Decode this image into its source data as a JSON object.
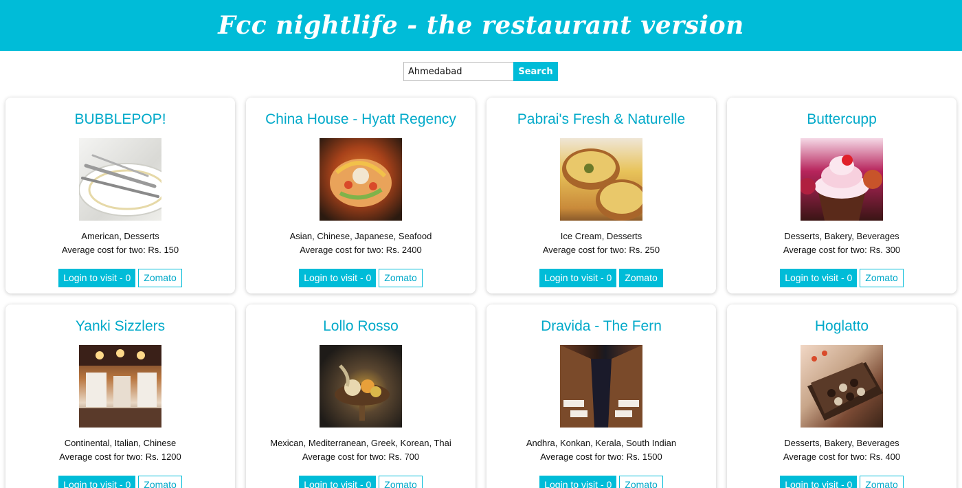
{
  "header": {
    "title": "Fcc nightlife - the restaurant version"
  },
  "search": {
    "value": "Ahmedabad",
    "button_label": "Search"
  },
  "colors": {
    "accent": "#00bcd8",
    "title_text": "#00a9c9"
  },
  "restaurants": [
    {
      "name": "BUBBLEPOP!",
      "cuisine": "American, Desserts",
      "cost": "Average cost for two: Rs. 150",
      "login_label": "Login to visit - 0",
      "zomato_label": "Zomato",
      "image_icon": "plate-cutlery-icon"
    },
    {
      "name": "China House - Hyatt Regency",
      "cuisine": "Asian, Chinese, Japanese, Seafood",
      "cost": "Average cost for two: Rs. 2400",
      "login_label": "Login to visit - 0",
      "zomato_label": "Zomato",
      "image_icon": "salad-dish-icon"
    },
    {
      "name": "Pabrai's Fresh & Naturelle",
      "cuisine": "Ice Cream, Desserts",
      "cost": "Average cost for two: Rs. 250",
      "login_label": "Login to visit - 0",
      "zomato_label": "Zomato",
      "image_icon": "dessert-bowl-icon"
    },
    {
      "name": "Buttercupp",
      "cuisine": "Desserts, Bakery, Beverages",
      "cost": "Average cost for two: Rs. 300",
      "login_label": "Login to visit - 0",
      "zomato_label": "Zomato",
      "image_icon": "cupcake-icon"
    },
    {
      "name": "Yanki Sizzlers",
      "cuisine": "Continental, Italian, Chinese",
      "cost": "Average cost for two: Rs. 1200",
      "login_label": "Login to visit - 0",
      "zomato_label": "Zomato",
      "image_icon": "restaurant-interior-icon"
    },
    {
      "name": "Lollo Rosso",
      "cuisine": "Mexican, Mediterranean, Greek, Korean, Thai",
      "cost": "Average cost for two: Rs. 700",
      "login_label": "Login to visit - 0",
      "zomato_label": "Zomato",
      "image_icon": "platter-icon"
    },
    {
      "name": "Dravida - The Fern",
      "cuisine": "Andhra, Konkan, Kerala, South Indian",
      "cost": "Average cost for two: Rs. 1500",
      "login_label": "Login to visit - 0",
      "zomato_label": "Zomato",
      "image_icon": "dining-hall-icon"
    },
    {
      "name": "Hoglatto",
      "cuisine": "Desserts, Bakery, Beverages",
      "cost": "Average cost for two: Rs. 400",
      "login_label": "Login to visit - 0",
      "zomato_label": "Zomato",
      "image_icon": "chocolate-box-icon"
    }
  ]
}
